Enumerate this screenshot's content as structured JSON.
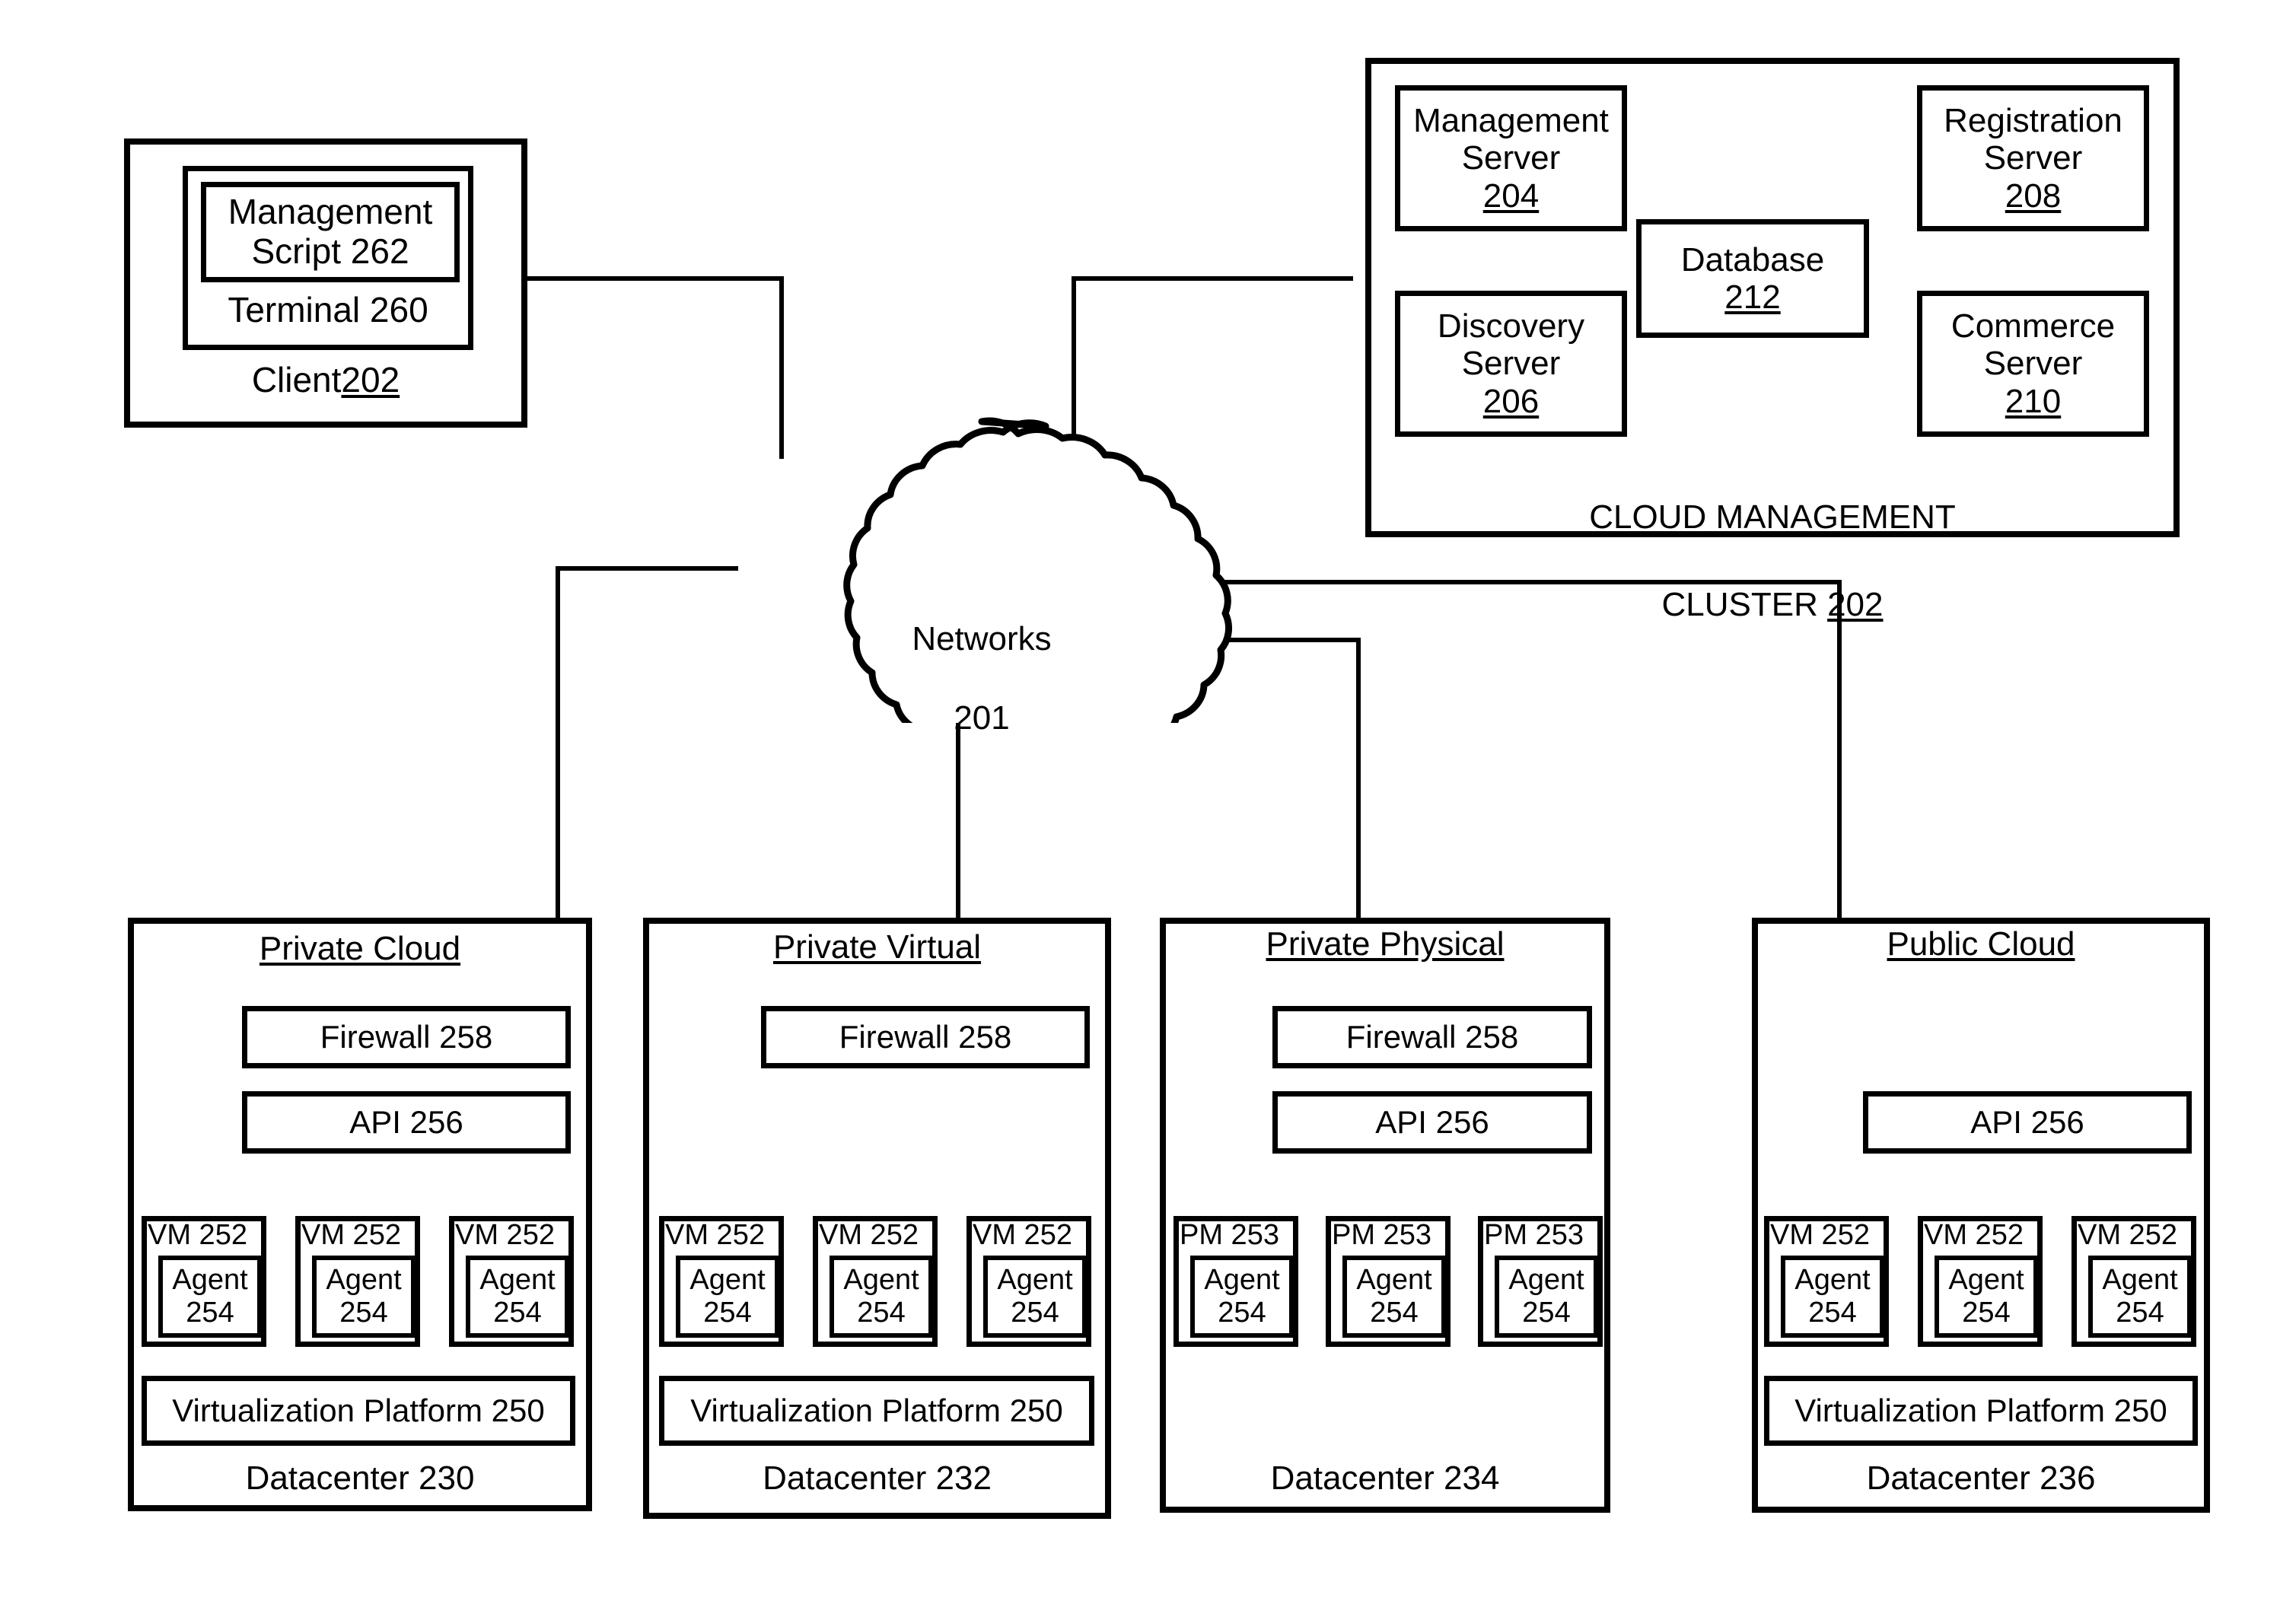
{
  "diagram": {
    "title": "Cloud Management Architecture",
    "line_color": "#000000",
    "background_color": "#ffffff"
  },
  "client": {
    "outer_label": "Client ",
    "outer_ref": "202",
    "terminal_label": "Terminal 260",
    "script_label": "Management\nScript 262"
  },
  "cluster": {
    "caption_line1": "CLOUD MANAGEMENT",
    "caption_line2": "CLUSTER ",
    "caption_ref": "202",
    "servers": [
      {
        "name": "management-server",
        "label": "Management\nServer",
        "ref": "204"
      },
      {
        "name": "registration-server",
        "label": "Registration\nServer",
        "ref": "208"
      },
      {
        "name": "discovery-server",
        "label": "Discovery\nServer",
        "ref": "206"
      },
      {
        "name": "commerce-server",
        "label": "Commerce\nServer",
        "ref": "210"
      },
      {
        "name": "database",
        "label": "Database",
        "ref": "212"
      }
    ]
  },
  "network": {
    "label": "Networks",
    "ref": "201",
    "icon": "cloud-icon"
  },
  "datacenters": [
    {
      "name": "private-cloud",
      "header": "Private Cloud",
      "firewall": "Firewall 258",
      "api": "API 256",
      "machine_label": "VM 252",
      "agent_label": "Agent\n254",
      "machine_count": 3,
      "platform": "Virtualization Platform 250",
      "footer": "Datacenter 230",
      "has_firewall": true,
      "has_api": true,
      "has_platform": true
    },
    {
      "name": "private-virtual",
      "header": "Private Virtual",
      "firewall": "Firewall 258",
      "api": "",
      "machine_label": "VM 252",
      "agent_label": "Agent\n254",
      "machine_count": 3,
      "platform": "Virtualization Platform 250",
      "footer": "Datacenter 232",
      "has_firewall": true,
      "has_api": false,
      "has_platform": true
    },
    {
      "name": "private-physical",
      "header": "Private Physical",
      "firewall": "Firewall 258",
      "api": "API 256",
      "machine_label": "PM 253",
      "agent_label": "Agent\n254",
      "machine_count": 3,
      "platform": "",
      "footer": "Datacenter 234",
      "has_firewall": true,
      "has_api": true,
      "has_platform": false
    },
    {
      "name": "public-cloud",
      "header": "Public Cloud",
      "firewall": "",
      "api": "API 256",
      "machine_label": "VM 252",
      "agent_label": "Agent\n254",
      "machine_count": 3,
      "platform": "Virtualization Platform 250",
      "footer": "Datacenter 236",
      "has_firewall": false,
      "has_api": true,
      "has_platform": true
    }
  ]
}
